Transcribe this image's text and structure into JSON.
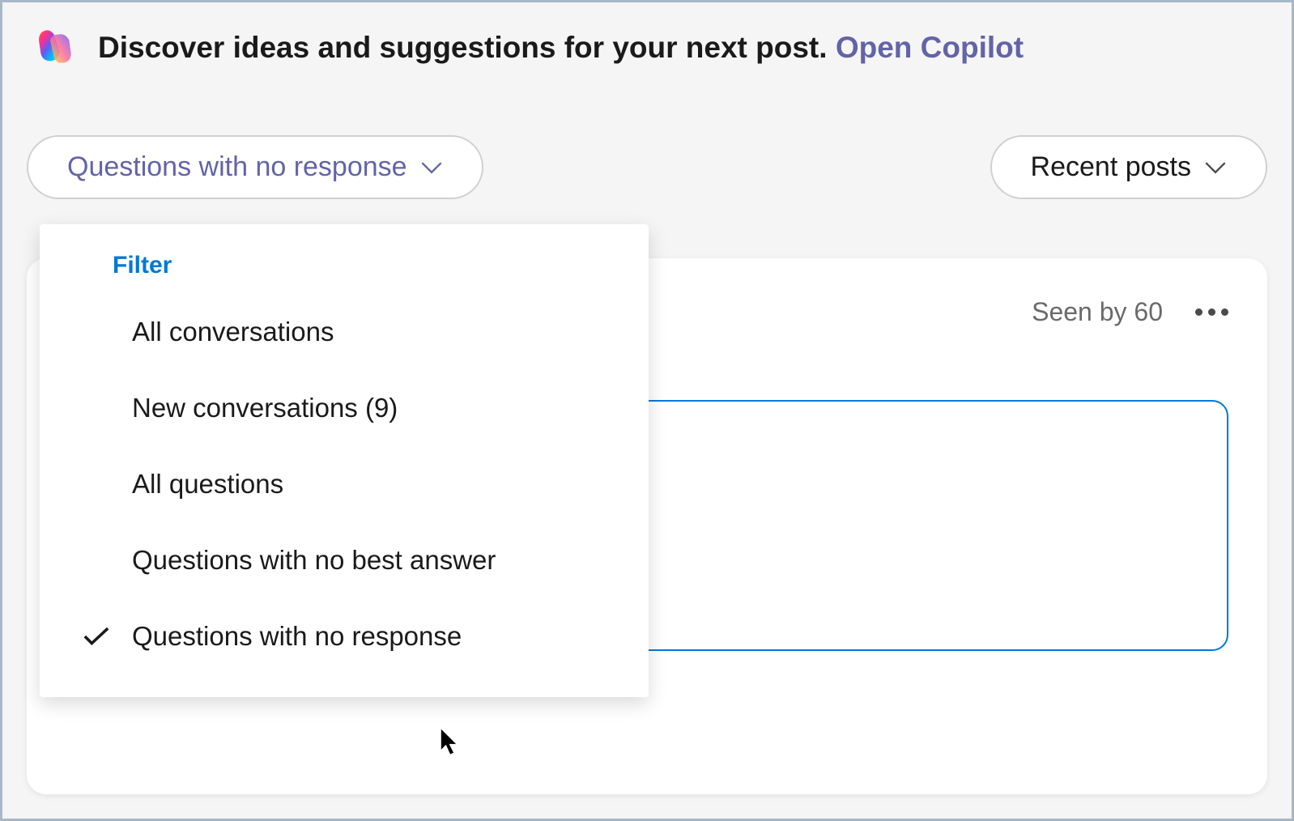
{
  "banner": {
    "text": "Discover ideas and suggestions for your next post. ",
    "link": "Open Copilot"
  },
  "filterBar": {
    "activeFilter": "Questions with no response",
    "sortButton": "Recent posts"
  },
  "dropdown": {
    "header": "Filter",
    "items": [
      {
        "label": "All conversations",
        "selected": false
      },
      {
        "label": "New conversations (9)",
        "selected": false
      },
      {
        "label": "All questions",
        "selected": false
      },
      {
        "label": "Questions with no best answer",
        "selected": false
      },
      {
        "label": "Questions with no response",
        "selected": true
      }
    ]
  },
  "post": {
    "seenBy": "Seen by 60"
  }
}
